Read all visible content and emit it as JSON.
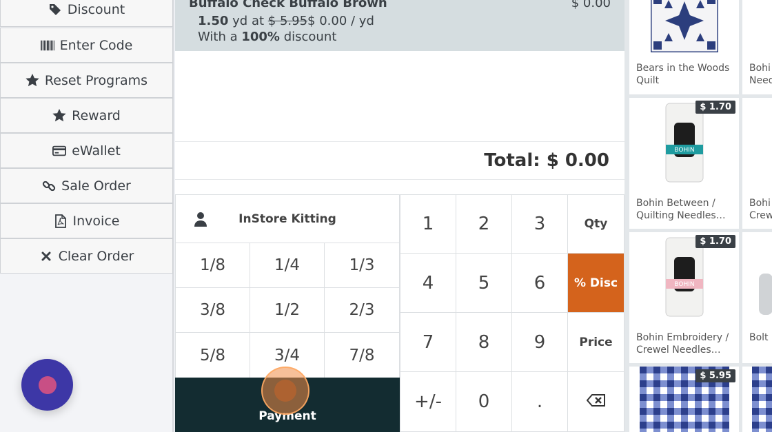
{
  "sidebar": {
    "items": [
      {
        "label": "Discount",
        "icon": "tag-icon"
      },
      {
        "label": "Enter Code",
        "icon": "barcode-icon"
      },
      {
        "label": "Reset Programs",
        "icon": "star-icon"
      },
      {
        "label": "Reward",
        "icon": "star-icon"
      },
      {
        "label": "eWallet",
        "icon": "credit-card-icon"
      },
      {
        "label": "Sale Order",
        "icon": "link-icon"
      },
      {
        "label": "Invoice",
        "icon": "pdf-file-icon"
      },
      {
        "label": "Clear Order",
        "icon": "close-icon"
      }
    ]
  },
  "order": {
    "item_name": "Buffalo Check Buffalo Brown",
    "line_price": "$ 0.00",
    "qty": "1.50",
    "unit_at": "yd at",
    "old_price": "$ 5.95",
    "new_price": "$ 0.00 / yd",
    "discount_prefix": "With a",
    "discount_value": "100%",
    "discount_suffix": "discount",
    "total": "Total: $ 0.00"
  },
  "keypad": {
    "customer": "InStore Kitting",
    "fractions": [
      "1/8",
      "1/4",
      "1/3",
      "3/8",
      "1/2",
      "2/3",
      "5/8",
      "3/4",
      "7/8"
    ],
    "numbers": [
      "1",
      "2",
      "3",
      "4",
      "5",
      "6",
      "7",
      "8",
      "9",
      "+/-",
      "0",
      "."
    ],
    "qty_label": "Qty",
    "disc_label": "% Disc",
    "price_label": "Price",
    "payment_label": "Payment"
  },
  "products": [
    {
      "title": "Bears in the Woods Quilt",
      "price": ""
    },
    {
      "title": "Bohi Need",
      "price": ""
    },
    {
      "title": "Bohin Between / Quilting Needles…",
      "price": "$ 1.70"
    },
    {
      "title": "Bohi Crew",
      "price": ""
    },
    {
      "title": "Bohin Embroidery / Crewel Needles…",
      "price": "$ 1.70"
    },
    {
      "title": "Bolt",
      "price": ""
    },
    {
      "title": "",
      "price": "$ 5.95"
    }
  ],
  "colors": {
    "accent_orange": "#d4631c",
    "payment_dark": "#132c31",
    "chat_purple": "#3d37a6"
  }
}
